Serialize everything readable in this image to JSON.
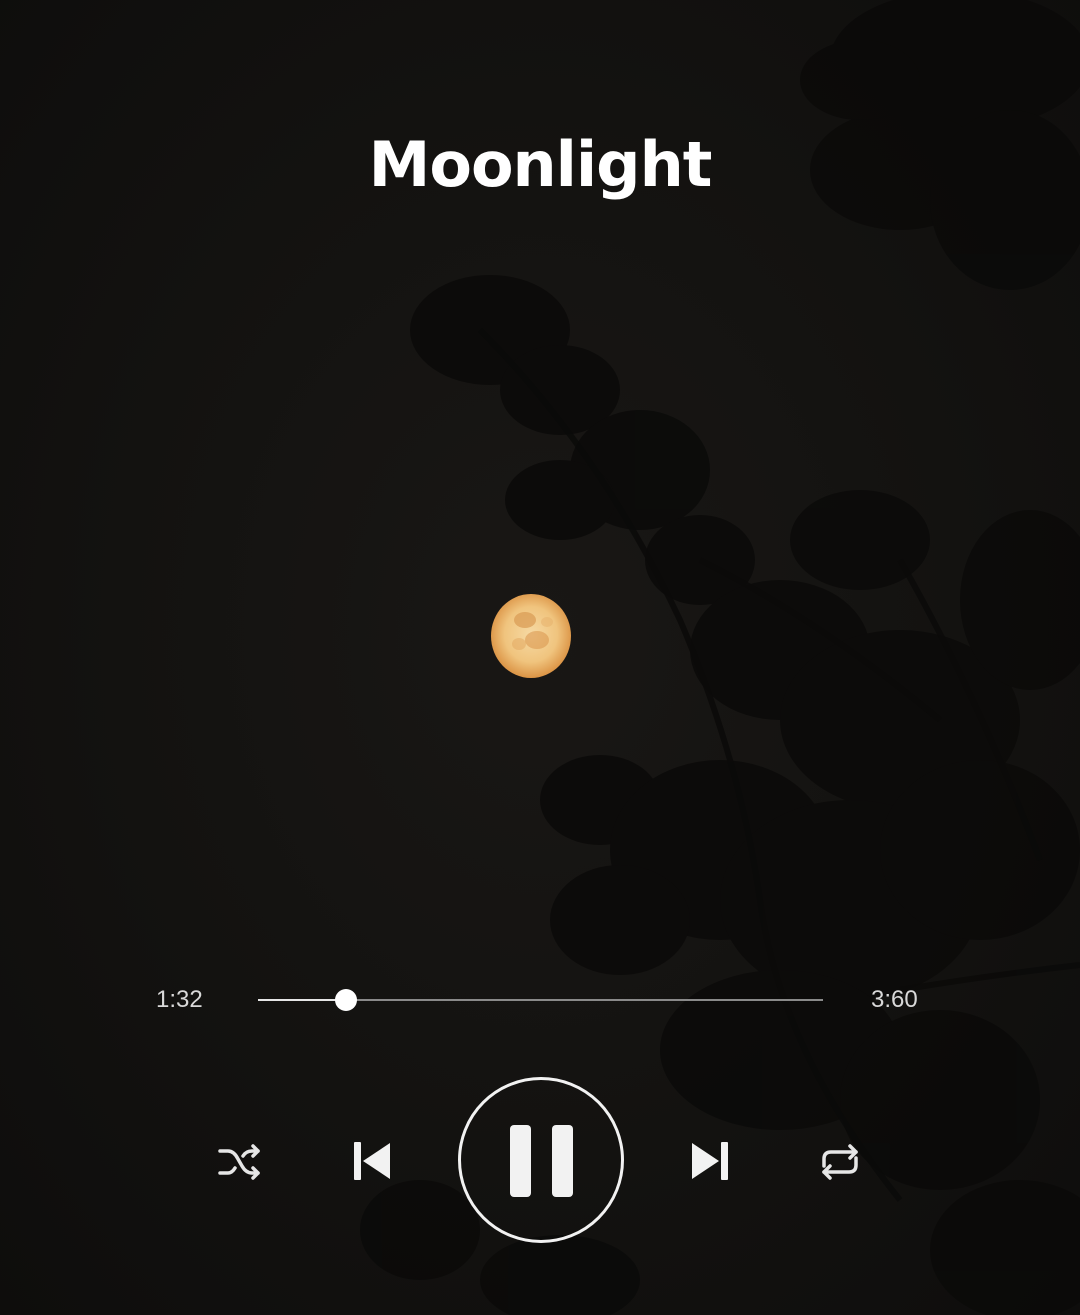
{
  "player": {
    "song_title": "Moonlight",
    "time_current": "1:32",
    "time_total": "3:60",
    "progress": 0.155
  },
  "controls": {
    "shuffle": {
      "icon": "shuffle-icon"
    },
    "previous": {
      "icon": "skip-previous-icon"
    },
    "pause": {
      "icon": "pause-icon"
    },
    "next": {
      "icon": "skip-next-icon"
    },
    "repeat": {
      "icon": "repeat-icon"
    }
  },
  "colors": {
    "background": "#121110",
    "foreground": "#ffffff",
    "moon": "#e8a85a"
  }
}
